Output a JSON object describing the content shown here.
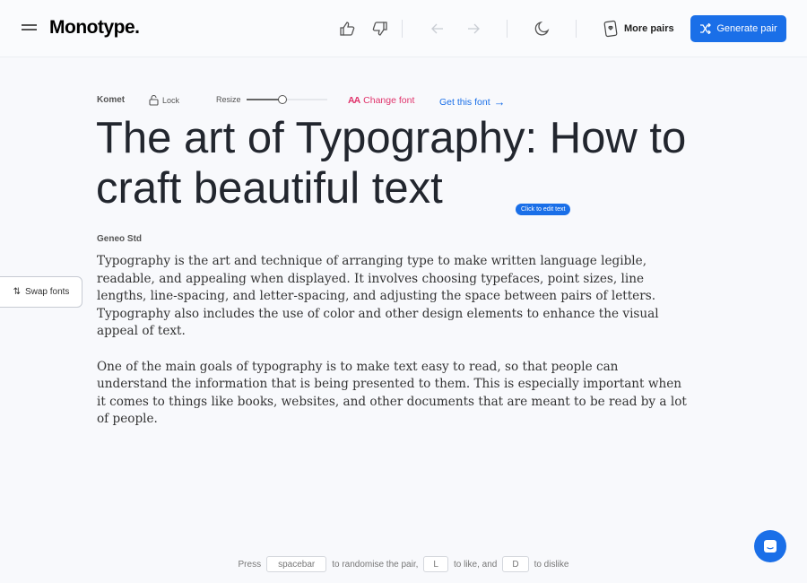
{
  "header": {
    "logo": "Monotype.",
    "more_pairs": "More pairs",
    "generate": "Generate pair",
    "accent": "#1a6fe8"
  },
  "toolbar": {
    "heading_font": "Komet",
    "lock": "Lock",
    "resize": "Resize",
    "resize_value_percent": 45,
    "change_font": "Change font",
    "get_font": "Get this font",
    "change_color": "#e0336b"
  },
  "heading": "The art of Typography: How to craft beautiful text",
  "tooltip": "Click to edit text",
  "body_font": "Geneo Std",
  "paragraphs": [
    "Typography is the art and technique of arranging type to make written language legible, readable, and appealing when displayed. It involves choosing typefaces, point sizes, line lengths, line-spacing, and letter-spacing, and adjusting the space between pairs of letters. Typography also includes the use of color and other design elements to enhance the visual appeal of text.",
    "One of the main goals of typography is to make text easy to read, so that people can understand the information that is being presented to them. This is especially important when it comes to things like books, websites, and other documents that are meant to be read by a lot of people."
  ],
  "swap": "Swap fonts",
  "footer": {
    "press": "Press",
    "space": "spacebar",
    "t1": "to randomise the pair,",
    "l": "L",
    "t2": "to like, and",
    "d": "D",
    "t3": "to dislike"
  }
}
